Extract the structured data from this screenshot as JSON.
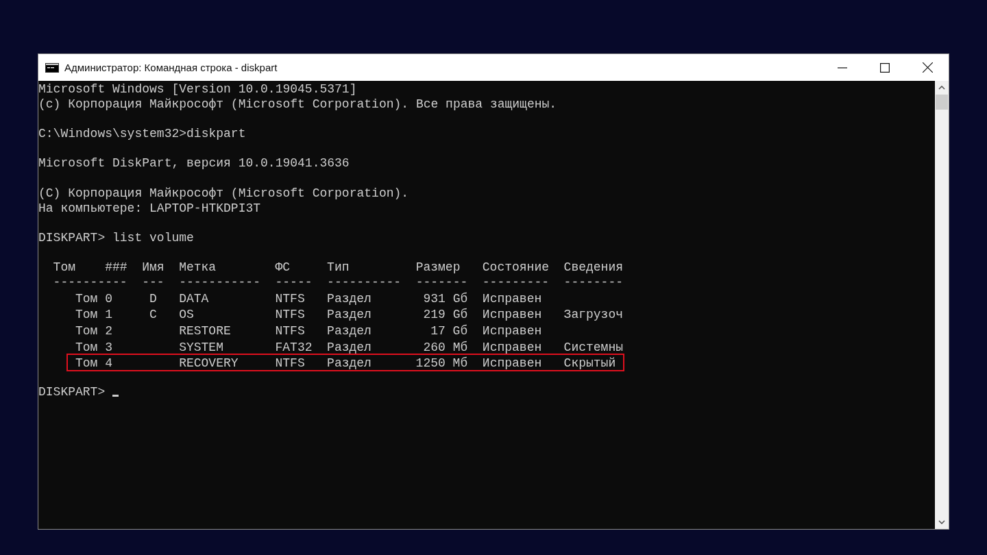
{
  "window": {
    "title": "Администратор: Командная строка - diskpart"
  },
  "console": {
    "blocks": [
      [
        "Microsoft Windows [Version 10.0.19045.5371]",
        "(c) Корпорация Майкрософт (Microsoft Corporation). Все права защищены."
      ],
      [
        "C:\\Windows\\system32>diskpart"
      ],
      [
        "Microsoft DiskPart, версия 10.0.19041.3636"
      ],
      [
        "(C) Корпорация Майкрософт (Microsoft Corporation).",
        "На компьютере: LAPTOP-HTKDPI3T"
      ],
      [
        "DISKPART> list volume"
      ]
    ],
    "table": {
      "header": [
        "Том",
        "###",
        "Имя",
        "Метка",
        "ФС",
        "Тип",
        "Размер",
        "Состояние",
        "Сведения"
      ],
      "separators": [
        "----------",
        "---",
        "-----------",
        "-----",
        "----------",
        "-------",
        "---------",
        "--------"
      ],
      "rows": [
        {
          "volume": "Том 0",
          "letter": "D",
          "label": "DATA",
          "fs": "NTFS",
          "type": "Раздел",
          "size": "931 Gб",
          "status": "Исправен",
          "highlighted": false
        },
        {
          "volume": "Том 1",
          "letter": "C",
          "label": "OS",
          "fs": "NTFS",
          "type": "Раздел",
          "size": "219 Gб",
          "status": "Исправен",
          "info": "Загрузоч",
          "highlighted": false
        },
        {
          "volume": "Том 2",
          "label": "RESTORE",
          "fs": "NTFS",
          "type": "Раздел",
          "size": "17 Gб",
          "status": "Исправен",
          "highlighted": false
        },
        {
          "volume": "Том 3",
          "label": "SYSTEM",
          "fs": "FAT32",
          "type": "Раздел",
          "size": "260 Мб",
          "status": "Исправен",
          "info": "Системны",
          "highlighted": false
        },
        {
          "volume": "Том 4",
          "label": "RECOVERY",
          "fs": "NTFS",
          "type": "Раздел",
          "size": "1250 Мб",
          "status": "Исправен",
          "info": "Скрытый",
          "highlighted": true
        }
      ]
    },
    "prompt": "DISKPART>"
  }
}
